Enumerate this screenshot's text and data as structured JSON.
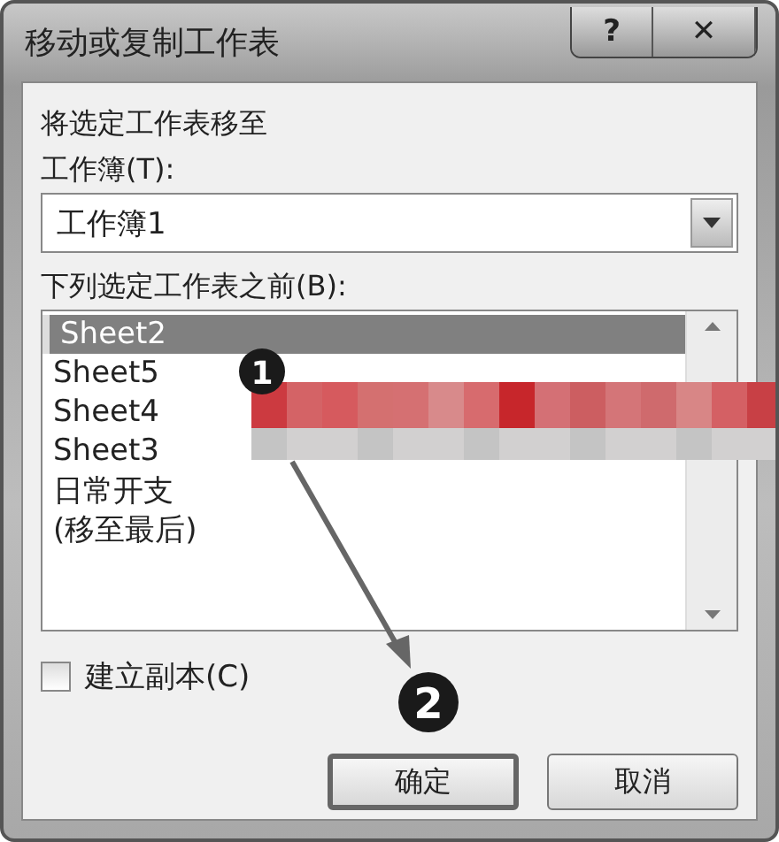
{
  "window": {
    "title": "移动或复制工作表",
    "help_button": "?",
    "close_button": "✕"
  },
  "move_label": "将选定工作表移至",
  "workbook": {
    "label": "工作簿(T):",
    "value": "工作簿1"
  },
  "sheets": {
    "label": "下列选定工作表之前(B):",
    "items": [
      {
        "label": "Sheet2",
        "selected": true
      },
      {
        "label": "Sheet5",
        "selected": false
      },
      {
        "label": "Sheet4",
        "selected": false
      },
      {
        "label": "Sheet3",
        "selected": false
      },
      {
        "label": "日常开支",
        "selected": false
      },
      {
        "label": "(移至最后)",
        "selected": false
      }
    ]
  },
  "copy_checkbox": {
    "label": "建立副本(C)",
    "checked": false
  },
  "buttons": [
    {
      "label": "确定",
      "default": true
    },
    {
      "label": "取消",
      "default": false
    }
  ],
  "annotations": [
    "1",
    "2"
  ]
}
